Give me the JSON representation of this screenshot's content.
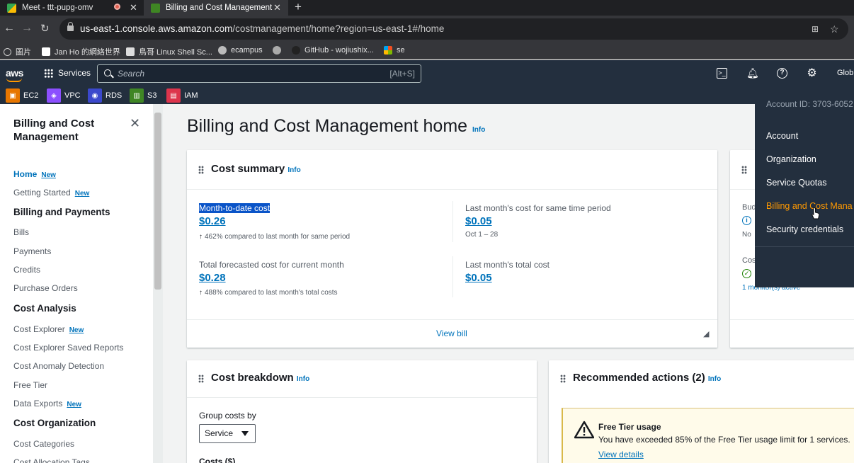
{
  "browser": {
    "tabs": [
      {
        "title": "Meet - ttt-pupg-omv",
        "active": false
      },
      {
        "title": "Billing and Cost Management",
        "active": true
      }
    ],
    "url_host": "us-east-1.console.aws.amazon.com",
    "url_path": "/costmanagement/home?region=us-east-1#/home",
    "bookmarks": [
      "圖片",
      "Jan Ho 的網絡世界",
      "鳥哥 Linux Shell Sc...",
      "ecampus",
      "",
      "GitHub - wojiushix...",
      "se"
    ]
  },
  "aws": {
    "logo": "aws",
    "services_label": "Services",
    "search_placeholder": "Search",
    "search_shortcut": "[Alt+S]",
    "global_label": "Glob",
    "favorites": [
      {
        "label": "EC2",
        "color": "#e77600"
      },
      {
        "label": "VPC",
        "color": "#8c4fff"
      },
      {
        "label": "RDS",
        "color": "#3b48cc"
      },
      {
        "label": "S3",
        "color": "#3f8624"
      },
      {
        "label": "IAM",
        "color": "#dd344c"
      }
    ]
  },
  "sidebar": {
    "title": "Billing and Cost Management",
    "items": [
      {
        "label": "Home",
        "new": "New"
      },
      {
        "label": "Getting Started",
        "new": "New"
      },
      {
        "label": "Billing and Payments"
      },
      {
        "label": "Bills"
      },
      {
        "label": "Payments"
      },
      {
        "label": "Credits"
      },
      {
        "label": "Purchase Orders"
      },
      {
        "label": "Cost Analysis"
      },
      {
        "label": "Cost Explorer",
        "new": "New"
      },
      {
        "label": "Cost Explorer Saved Reports"
      },
      {
        "label": "Cost Anomaly Detection"
      },
      {
        "label": "Free Tier"
      },
      {
        "label": "Data Exports",
        "new": "New"
      },
      {
        "label": "Cost Organization"
      },
      {
        "label": "Cost Categories"
      },
      {
        "label": "Cost Allocation Tags"
      }
    ]
  },
  "main": {
    "title": "Billing and Cost Management home",
    "info": "Info",
    "cost_summary": {
      "title": "Cost summary",
      "mtd_label": "Month-to-date cost",
      "mtd_value": "$0.26",
      "mtd_compare": "462% compared to last month for same period",
      "last_same_label": "Last month's cost for same time period",
      "last_same_value": "$0.05",
      "last_same_range": "Oct 1 – 28",
      "forecast_label": "Total forecasted cost for current month",
      "forecast_value": "$0.28",
      "forecast_compare": "488% compared to last month's total costs",
      "last_total_label": "Last month's total cost",
      "last_total_value": "$0.05",
      "view_bill": "View bill"
    },
    "right_card": {
      "bud": "Bud",
      "no": "No",
      "cos": "Cos",
      "monitors": "1 monitor(s) active"
    },
    "cost_breakdown": {
      "title": "Cost breakdown",
      "group_label": "Group costs by",
      "group_value": "Service",
      "costs_label": "Costs ($)"
    },
    "recommended": {
      "title": "Recommended actions (2)",
      "alert_title": "Free Tier usage",
      "alert_text": "You have exceeded 85% of the Free Tier usage limit for 1 services.",
      "alert_link": "View details"
    }
  },
  "account_menu": {
    "account_id": "Account ID: 3703-6052",
    "items": [
      "Account",
      "Organization",
      "Service Quotas",
      "Billing and Cost Mana",
      "Security credentials"
    ]
  }
}
